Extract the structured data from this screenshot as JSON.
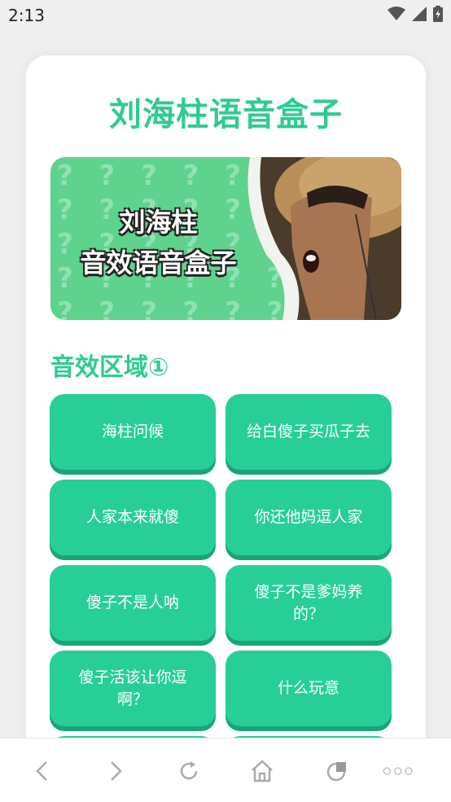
{
  "status": {
    "time": "2:13",
    "icons": [
      "wifi-icon",
      "signal-icon",
      "battery-icon"
    ]
  },
  "app": {
    "title": "刘海柱语音盒子"
  },
  "banner": {
    "line1": "刘海柱",
    "line2": "音效语音盒子"
  },
  "section": {
    "title": "音效区域①"
  },
  "sounds": [
    {
      "label": "海柱问候"
    },
    {
      "label": "给白傻子买瓜子去"
    },
    {
      "label": "人家本来就傻"
    },
    {
      "label": "你还他妈逗人家"
    },
    {
      "label": "傻子不是人呐"
    },
    {
      "label": "傻子不是爹妈养的？"
    },
    {
      "label": "傻子活该让你逗啊？"
    },
    {
      "label": "什么玩意"
    }
  ],
  "nav": {
    "icons": [
      "back-icon",
      "forward-icon",
      "refresh-icon",
      "home-icon",
      "tabs-icon",
      "menu-icon"
    ]
  },
  "colors": {
    "accent": "#2ecc8f",
    "button": "#27cf97",
    "button_shadow": "#19a574",
    "banner": "#5fd28e"
  }
}
